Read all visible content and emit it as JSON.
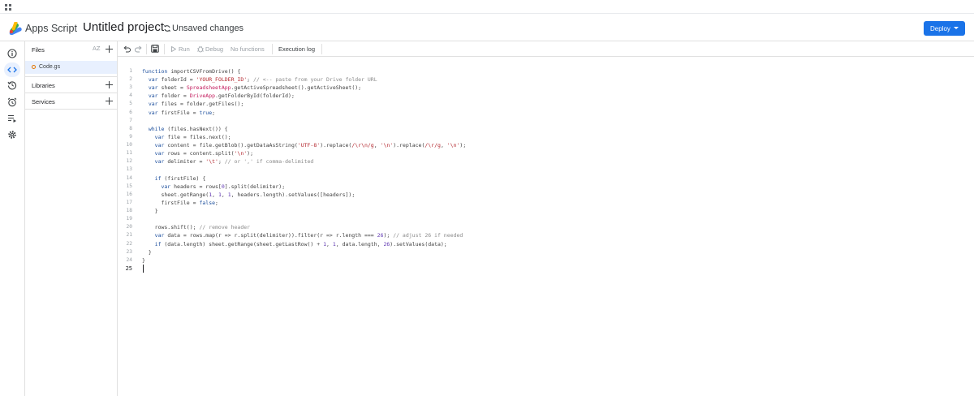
{
  "header": {
    "app_name": "Apps Script",
    "project_title": "Untitled project",
    "status": "Unsaved changes",
    "deploy_label": "Deploy"
  },
  "rail": {
    "items": [
      "overview",
      "editor",
      "triggers",
      "executions",
      "settings"
    ]
  },
  "files_panel": {
    "files_label": "Files",
    "sort_label": "AZ",
    "files": [
      {
        "name": "Code.gs"
      }
    ],
    "libraries_label": "Libraries",
    "services_label": "Services"
  },
  "toolbar": {
    "run_label": "Run",
    "debug_label": "Debug",
    "function_label": "No functions",
    "execution_log_label": "Execution log"
  },
  "editor": {
    "current_line": 25,
    "lines": [
      "function importCSVFromDrive() {",
      "  var folderId = 'YOUR_FOLDER_ID'; // <-- paste from your Drive folder URL",
      "  var sheet = SpreadsheetApp.getActiveSpreadsheet().getActiveSheet();",
      "  var folder = DriveApp.getFolderById(folderId);",
      "  var files = folder.getFiles();",
      "  var firstFile = true;",
      "",
      "  while (files.hasNext()) {",
      "    var file = files.next();",
      "    var content = file.getBlob().getDataAsString('UTF-8').replace(/\\r\\n/g, '\\n').replace(/\\r/g, '\\n');",
      "    var rows = content.split('\\n');",
      "    var delimiter = '\\t'; // or ',' if comma-delimited",
      "",
      "    if (firstFile) {",
      "      var headers = rows[0].split(delimiter);",
      "      sheet.getRange(1, 1, 1, headers.length).setValues([headers]);",
      "      firstFile = false;",
      "    }",
      "",
      "    rows.shift(); // remove header",
      "    var data = rows.map(r => r.split(delimiter)).filter(r => r.length === 26); // adjust 26 if needed",
      "    if (data.length) sheet.getRange(sheet.getLastRow() + 1, 1, data.length, 26).setValues(data);",
      "  }",
      "}",
      ""
    ]
  }
}
